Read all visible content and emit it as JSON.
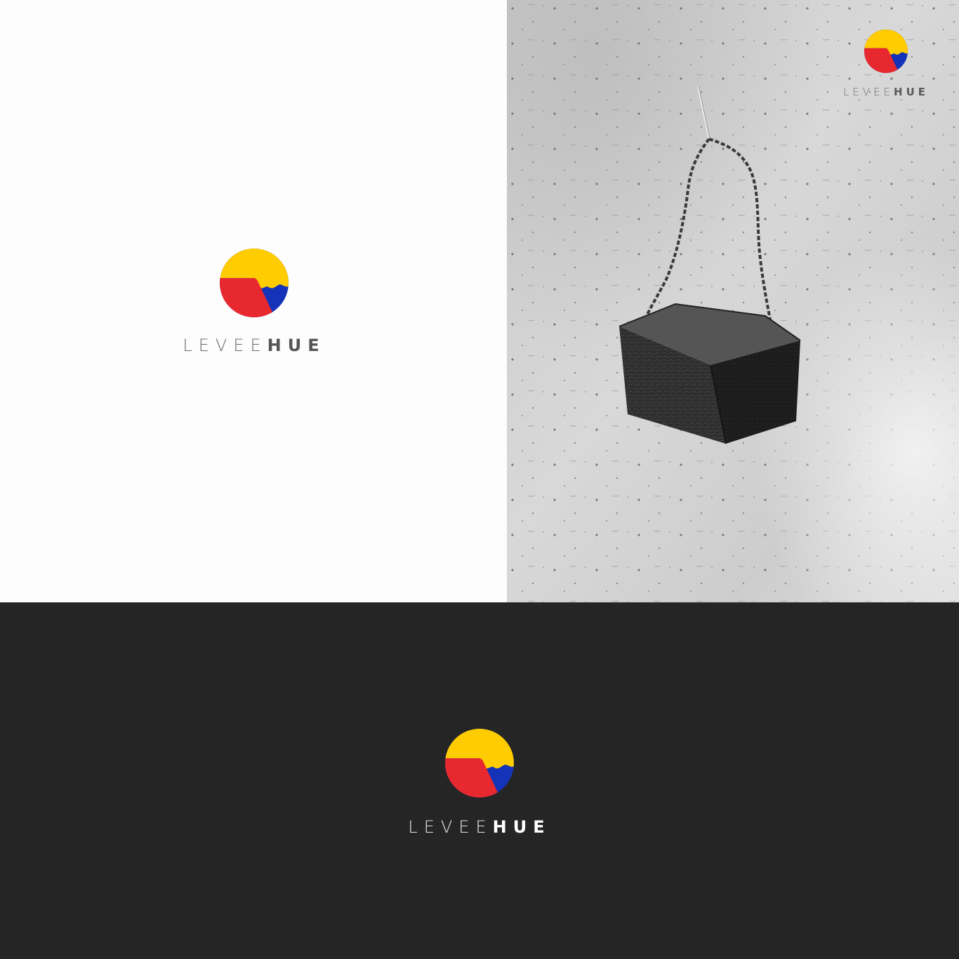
{
  "brand": {
    "name_light": "LEVEE",
    "name_bold": "HUE",
    "colors": {
      "yellow": "#FFCC00",
      "red": "#E8282F",
      "blue": "#1533B8",
      "light_bg": "#FDFDFD",
      "dark_bg": "#252525"
    }
  },
  "photo": {
    "subject": "black leather chain handbag hanging on concrete wall (grayscale photo)"
  }
}
